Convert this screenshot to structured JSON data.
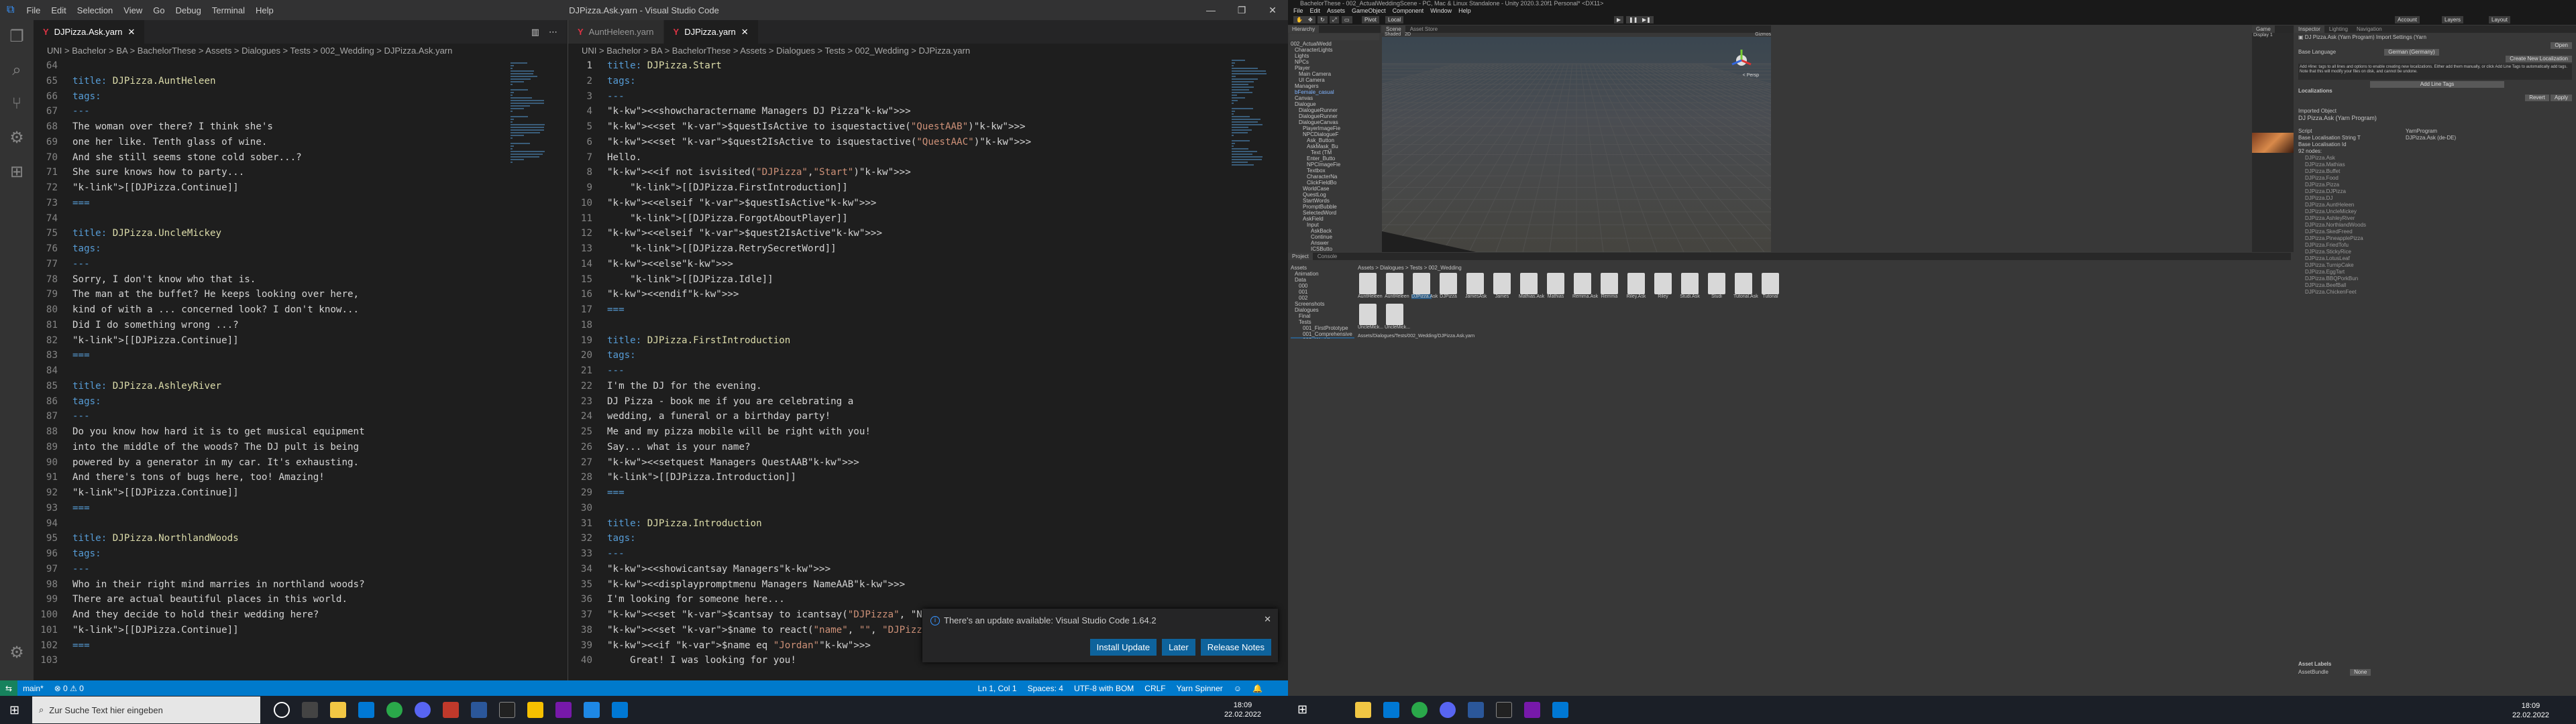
{
  "vscode": {
    "window_title": "DJPizza.Ask.yarn - Visual Studio Code",
    "menu": [
      "File",
      "Edit",
      "Selection",
      "View",
      "Go",
      "Debug",
      "Terminal",
      "Help"
    ],
    "left_tab": "DJPizza.Ask.yarn",
    "right_tabs": [
      "AuntHeleen.yarn",
      "DJPizza.yarn"
    ],
    "left_crumbs": "UNI > Bachelor > BA > BachelorThese > Assets > Dialogues > Tests > 002_Wedding > DJPizza.Ask.yarn",
    "right_crumbs": "UNI > Bachelor > BA > BachelorThese > Assets > Dialogues > Tests > 002_Wedding > DJPizza.yarn",
    "left_code": [
      {
        "n": "64",
        "t": ""
      },
      {
        "n": "65",
        "t": "title: DJPizza.AuntHeleen"
      },
      {
        "n": "66",
        "t": "tags:"
      },
      {
        "n": "67",
        "t": "---"
      },
      {
        "n": "68",
        "t": "The woman over there? I think she's"
      },
      {
        "n": "69",
        "t": "one her like. Tenth glass of wine."
      },
      {
        "n": "70",
        "t": "And she still seems stone cold sober...?"
      },
      {
        "n": "71",
        "t": "She sure knows how to party..."
      },
      {
        "n": "72",
        "t": "[[DJPizza.Continue]]"
      },
      {
        "n": "73",
        "t": "==="
      },
      {
        "n": "74",
        "t": ""
      },
      {
        "n": "75",
        "t": "title: DJPizza.UncleMickey"
      },
      {
        "n": "76",
        "t": "tags:"
      },
      {
        "n": "77",
        "t": "---"
      },
      {
        "n": "78",
        "t": "Sorry, I don't know who that is."
      },
      {
        "n": "79",
        "t": "The man at the buffet? He keeps looking over here,"
      },
      {
        "n": "80",
        "t": "kind of with a ... concerned look? I don't know..."
      },
      {
        "n": "81",
        "t": "Did I do something wrong ...?"
      },
      {
        "n": "82",
        "t": "[[DJPizza.Continue]]"
      },
      {
        "n": "83",
        "t": "==="
      },
      {
        "n": "84",
        "t": ""
      },
      {
        "n": "85",
        "t": "title: DJPizza.AshleyRiver"
      },
      {
        "n": "86",
        "t": "tags:"
      },
      {
        "n": "87",
        "t": "---"
      },
      {
        "n": "88",
        "t": "Do you know how hard it is to get musical equipment"
      },
      {
        "n": "89",
        "t": "into the middle of the woods? The DJ pult is being"
      },
      {
        "n": "90",
        "t": "powered by a generator in my car. It's exhausting."
      },
      {
        "n": "91",
        "t": "And there's tons of bugs here, too! Amazing!"
      },
      {
        "n": "92",
        "t": "[[DJPizza.Continue]]"
      },
      {
        "n": "93",
        "t": "==="
      },
      {
        "n": "94",
        "t": ""
      },
      {
        "n": "95",
        "t": "title: DJPizza.NorthlandWoods"
      },
      {
        "n": "96",
        "t": "tags:"
      },
      {
        "n": "97",
        "t": "---"
      },
      {
        "n": "98",
        "t": "Who in their right mind marries in northland woods?"
      },
      {
        "n": "99",
        "t": "There are actual beautiful places in this world."
      },
      {
        "n": "100",
        "t": "And they decide to hold their wedding here?"
      },
      {
        "n": "101",
        "t": "[[DJPizza.Continue]]"
      },
      {
        "n": "102",
        "t": "==="
      },
      {
        "n": "103",
        "t": ""
      }
    ],
    "right_code": [
      {
        "n": "1",
        "t": "title: DJPizza.Start"
      },
      {
        "n": "2",
        "t": "tags:"
      },
      {
        "n": "3",
        "t": "---"
      },
      {
        "n": "4",
        "t": "<<showcharactername Managers DJ Pizza>>"
      },
      {
        "n": "5",
        "t": "<<set $questIsActive to isquestactive(\"QuestAAB\")>>"
      },
      {
        "n": "6",
        "t": "<<set $quest2IsActive to isquestactive(\"QuestAAC\")>>"
      },
      {
        "n": "7",
        "t": "Hello."
      },
      {
        "n": "8",
        "t": "<<if not isvisited(\"DJPizza\",\"Start\")>>"
      },
      {
        "n": "9",
        "t": "    [[DJPizza.FirstIntroduction]]"
      },
      {
        "n": "10",
        "t": "<<elseif $questIsActive>>"
      },
      {
        "n": "11",
        "t": "    [[DJPizza.ForgotAboutPlayer]]"
      },
      {
        "n": "12",
        "t": "<<elseif $quest2IsActive>>"
      },
      {
        "n": "13",
        "t": "    [[DJPizza.RetrySecretWord]]"
      },
      {
        "n": "14",
        "t": "<<else>>"
      },
      {
        "n": "15",
        "t": "    [[DJPizza.Idle]]"
      },
      {
        "n": "16",
        "t": "<<endif>>"
      },
      {
        "n": "17",
        "t": "==="
      },
      {
        "n": "18",
        "t": ""
      },
      {
        "n": "19",
        "t": "title: DJPizza.FirstIntroduction"
      },
      {
        "n": "20",
        "t": "tags:"
      },
      {
        "n": "21",
        "t": "---"
      },
      {
        "n": "22",
        "t": "I'm the DJ for the evening."
      },
      {
        "n": "23",
        "t": "DJ Pizza - book me if you are celebrating a"
      },
      {
        "n": "24",
        "t": "wedding, a funeral or a birthday party!"
      },
      {
        "n": "25",
        "t": "Me and my pizza mobile will be right with you!"
      },
      {
        "n": "26",
        "t": "Say... what is your name?"
      },
      {
        "n": "27",
        "t": "<<setquest Managers QuestAAB>>"
      },
      {
        "n": "28",
        "t": "[[DJPizza.Introduction]]"
      },
      {
        "n": "29",
        "t": "==="
      },
      {
        "n": "30",
        "t": ""
      },
      {
        "n": "31",
        "t": "title: DJPizza.Introduction"
      },
      {
        "n": "32",
        "t": "tags:"
      },
      {
        "n": "33",
        "t": "---"
      },
      {
        "n": "34",
        "t": "<<showicantsay Managers>>"
      },
      {
        "n": "35",
        "t": "<<displaypromptmenu Managers NameAAB>>"
      },
      {
        "n": "36",
        "t": "I'm looking for someone here..."
      },
      {
        "n": "37",
        "t": "<<set $cantsay to icantsay(\"DJPizza\", \"Nevermi"
      },
      {
        "n": "38",
        "t": "<<set $name to react(\"name\", \"\", \"DJPizza\")>>"
      },
      {
        "n": "39",
        "t": "<<if $name eq \"Jordan\">>"
      },
      {
        "n": "40",
        "t": "    Great! I was looking for you!"
      }
    ],
    "notification": {
      "message": "There's an update available: Visual Studio Code 1.64.2",
      "buttons": [
        "Install Update",
        "Later",
        "Release Notes"
      ]
    },
    "status": {
      "branch": "main*",
      "problems": "⊗ 0 ⚠ 0",
      "position": "Ln 1, Col 1",
      "spaces": "Spaces: 4",
      "encoding": "UTF-8 with BOM",
      "eol": "CRLF",
      "language": "Yarn Spinner"
    },
    "taskbar": {
      "search_placeholder": "Zur Suche Text hier eingeben",
      "time": "18:09",
      "date": "22.02.2022"
    }
  },
  "unity": {
    "window_title": "BachelorThese - 002_ActualWeddingScene - PC, Mac & Linux Standalone - Unity 2020.3.20f1 Personal* <DX11>",
    "menu": [
      "File",
      "Edit",
      "Assets",
      "GameObject",
      "Component",
      "Window",
      "Help"
    ],
    "toolbar": {
      "pivot": "Pivot",
      "local": "Local",
      "account": "Account",
      "layers": "Layers",
      "layout": "Layout"
    },
    "hierarchy": {
      "tab": "Hierarchy",
      "items": [
        "002_ActualWedd",
        "CharacterLights",
        "Lights",
        "NPCs",
        "Player",
        "Main Camera",
        "UI Camera",
        "Managers",
        "bFemale_casual",
        "Canvas",
        "Dialogue",
        "DialogueRunner",
        "DialogueRunner",
        "DialogueCanvas",
        "PlayerImageFie",
        "NPCDialogueF",
        "Ask_Button",
        "AskMask_Bu",
        "Text (TM",
        "Enter_Butto",
        "NPCImageFie",
        "Textbox",
        "CharacterNa",
        "ClickFieldBo",
        "WorldCase",
        "QuestLog",
        "StartWords",
        "PromptBubble",
        "SelectedWord",
        "AskField",
        "Input",
        "AskBack",
        "Continue",
        "Answer",
        "ICSButto",
        "NPCText",
        "AskPromptBut",
        "SelectedWord",
        "OtherUI"
      ]
    },
    "scene": {
      "tabs": [
        "Scene",
        "Asset Store"
      ],
      "shading": "Shaded",
      "mode": "2D",
      "gizmos": "Gizmos",
      "persp": "< Persp"
    },
    "game": {
      "tab": "Game",
      "display": "Display 1"
    },
    "project": {
      "tabs": [
        "Project",
        "Console"
      ],
      "breadcrumb": "Assets > Dialogues > Tests > 002_Wedding",
      "tree": [
        "Assets",
        "Animation",
        "Data",
        "000",
        "001",
        "002",
        "Screenshots",
        "Dialogues",
        "Final",
        "Tests",
        "001_FirstPrototype",
        "001_Comprehensive",
        "002_Wedding",
        "Images"
      ],
      "assets": [
        "AuntHeleen",
        "AuntHeleen",
        "DJPizza.Ask",
        "DJPizza",
        "JamesAsk",
        "James",
        "Mathias.Ask",
        "Mathias",
        "Remma.Ask",
        "Remma",
        "Riley.Ask",
        "Riley",
        "Studi.Ask",
        "Studi",
        "Tutorial.Ask",
        "Tutorial",
        "UncleMick...",
        "UncleMick..."
      ],
      "path": "Assets/Dialogues/Tests/002_Wedding/DJPizza.Ask.yarn"
    },
    "inspector": {
      "tabs": [
        "Inspector",
        "Lighting",
        "Navigation"
      ],
      "title": "DJ Pizza.Ask (Yarn Program) Import Settings (Yarn",
      "open": "Open",
      "base_language_label": "Base Language",
      "base_language": "German (Germany)",
      "create_loc": "Create New Localization",
      "info": "Add #line: tags to all lines and options to enable creating new localizations. Either add them manually, or click Add Line Tags to automatically add tags. Note that this will modify your files on disk, and cannot be undone.",
      "add_line_tags": "Add Line Tags",
      "localizations": "Localizations",
      "revert": "Revert",
      "apply": "Apply",
      "imported_object": "Imported Object",
      "imported_name": "DJ Pizza.Ask (Yarn Program)",
      "script_label": "Script",
      "script_val": "YarnProgram",
      "base_loc_label": "Base Localisation String T",
      "base_loc_val": "DJPizza.Ask (de-DE)",
      "base_loc_id": "Base Localisation Id",
      "nodes_count": "92 nodes:",
      "nodes": [
        "DJPizza.Ask",
        "DJPizza.Mathias",
        "DJPizza.Buffet",
        "DJPizza.Food",
        "DJPizza.Pizza",
        "DJPizza.DJPizza",
        "DJPizza.DJ",
        "DJPizza.AuntHeleen",
        "DJPizza.UncleMickey",
        "DJPizza.AshleyRiver",
        "DJPizza.NorthlandWoods",
        "DJPizza.SkedFreed",
        "DJPizza.PineapplePizza",
        "DJPizza.FriedTofu",
        "DJPizza.StickyRice",
        "DJPizza.LotusLeaf",
        "DJPizza.TurnipCake",
        "DJPizza.EggTart",
        "DJPizza.BBQPorkBun",
        "DJPizza.BeefBall",
        "DJPizza.ChickenFeet"
      ],
      "asset_labels": "Asset Labels",
      "asset_bundle": "AssetBundle",
      "none": "None"
    },
    "taskbar": {
      "time": "18:09",
      "date": "22.02.2022"
    }
  }
}
